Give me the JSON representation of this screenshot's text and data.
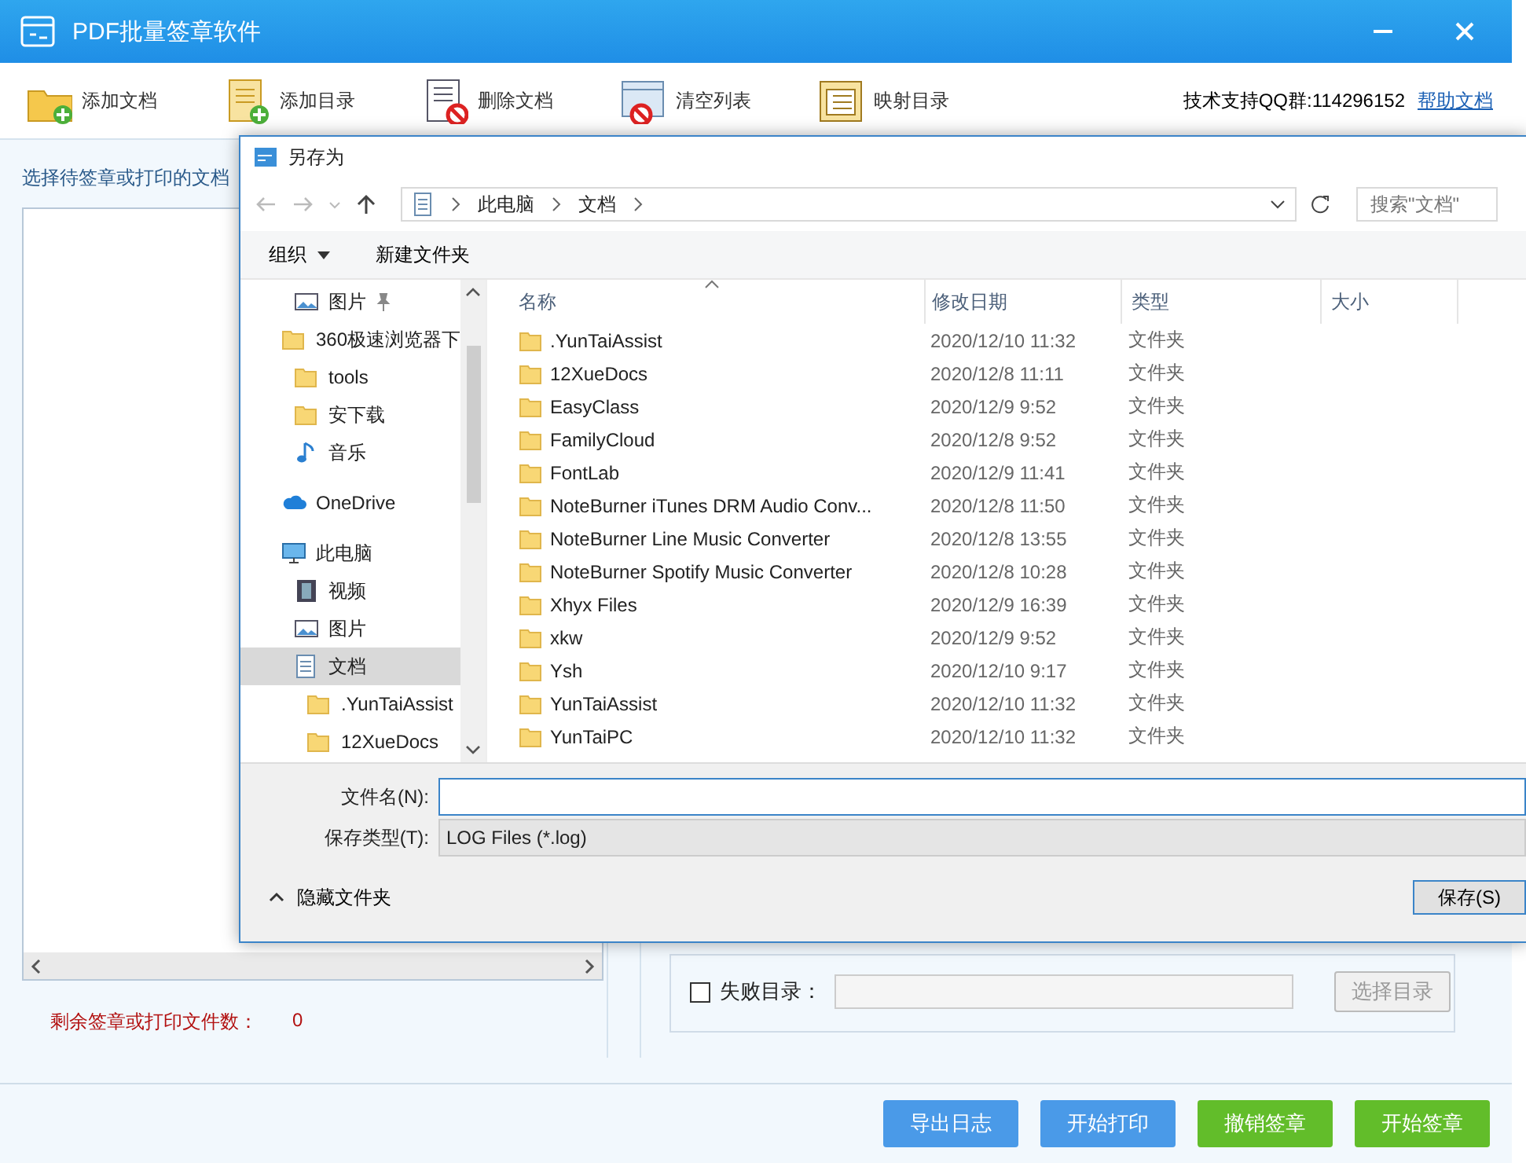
{
  "window": {
    "title": "PDF批量签章软件"
  },
  "toolbar": [
    {
      "label": "添加文档",
      "kind": "add-file"
    },
    {
      "label": "添加目录",
      "kind": "add-folder"
    },
    {
      "label": "删除文档",
      "kind": "delete"
    },
    {
      "label": "清空列表",
      "kind": "clear"
    },
    {
      "label": "映射目录",
      "kind": "map"
    }
  ],
  "support": {
    "text": "技术支持QQ群:114296152",
    "link": "帮助文档"
  },
  "left_panel": {
    "title": "选择待签章或打印的文档",
    "remaining_label": "剩余签章或打印文件数：",
    "remaining_value": "0"
  },
  "right_panel": {
    "failed_dir": {
      "label": "失败目录：",
      "checked": false,
      "button": "选择目录",
      "disabled": true
    }
  },
  "buttons": [
    {
      "label": "导出日志",
      "kind": "blue"
    },
    {
      "label": "开始打印",
      "kind": "blue"
    },
    {
      "label": "撤销签章",
      "kind": "green"
    },
    {
      "label": "开始签章",
      "kind": "green"
    }
  ],
  "dialog": {
    "title": "另存为",
    "breadcrumb": [
      "此电脑",
      "文档"
    ],
    "search": {
      "placeholder": "搜索\"文档\""
    },
    "commands": [
      {
        "label": "组织",
        "dropdown": true
      },
      {
        "label": "新建文件夹",
        "dropdown": false
      }
    ],
    "nav": [
      {
        "label": "图片",
        "kind": "pictures",
        "pinned": true,
        "selected": false
      },
      {
        "label": "360极速浏览器下",
        "kind": "folder",
        "pinned": false,
        "selected": false
      },
      {
        "label": "tools",
        "kind": "folder",
        "pinned": false,
        "selected": false
      },
      {
        "label": "安下载",
        "kind": "folder",
        "pinned": false,
        "selected": false
      },
      {
        "label": "音乐",
        "kind": "music",
        "pinned": false,
        "selected": false
      },
      {
        "label": "OneDrive",
        "kind": "cloud",
        "pinned": false,
        "selected": false
      },
      {
        "label": "此电脑",
        "kind": "pc",
        "pinned": false,
        "selected": false,
        "children": [
          {
            "label": "视频",
            "kind": "video",
            "pinned": false,
            "selected": false
          },
          {
            "label": "图片",
            "kind": "pictures",
            "pinned": false,
            "selected": false
          },
          {
            "label": "文档",
            "kind": "document",
            "pinned": false,
            "selected": true,
            "children": [
              {
                "label": ".YunTaiAssist",
                "kind": "folder",
                "pinned": false,
                "selected": false
              },
              {
                "label": "12XueDocs",
                "kind": "folder",
                "pinned": false,
                "selected": false
              }
            ]
          }
        ]
      }
    ],
    "columns": [
      "名称",
      "修改日期",
      "类型",
      "大小"
    ],
    "files": [
      {
        "name": ".YunTaiAssist",
        "date": "2020/12/10 11:32",
        "type": "文件夹"
      },
      {
        "name": "12XueDocs",
        "date": "2020/12/8 11:11",
        "type": "文件夹"
      },
      {
        "name": "EasyClass",
        "date": "2020/12/9 9:52",
        "type": "文件夹"
      },
      {
        "name": "FamilyCloud",
        "date": "2020/12/8 9:52",
        "type": "文件夹"
      },
      {
        "name": "FontLab",
        "date": "2020/12/9 11:41",
        "type": "文件夹"
      },
      {
        "name": "NoteBurner iTunes DRM Audio Conv...",
        "date": "2020/12/8 11:50",
        "type": "文件夹"
      },
      {
        "name": "NoteBurner Line Music Converter",
        "date": "2020/12/8 13:55",
        "type": "文件夹"
      },
      {
        "name": "NoteBurner Spotify Music Converter",
        "date": "2020/12/8 10:28",
        "type": "文件夹"
      },
      {
        "name": "Xhyx Files",
        "date": "2020/12/9 16:39",
        "type": "文件夹"
      },
      {
        "name": "xkw",
        "date": "2020/12/9 9:52",
        "type": "文件夹"
      },
      {
        "name": "Ysh",
        "date": "2020/12/10 9:17",
        "type": "文件夹"
      },
      {
        "name": "YunTaiAssist",
        "date": "2020/12/10 11:32",
        "type": "文件夹"
      },
      {
        "name": "YunTaiPC",
        "date": "2020/12/10 11:32",
        "type": "文件夹"
      }
    ],
    "filename": {
      "label": "文件名(N):"
    },
    "filetype": {
      "label": "保存类型(T):",
      "value": "LOG Files (*.log)"
    },
    "hide_folders": "隐藏文件夹",
    "save": "保存(S)"
  }
}
